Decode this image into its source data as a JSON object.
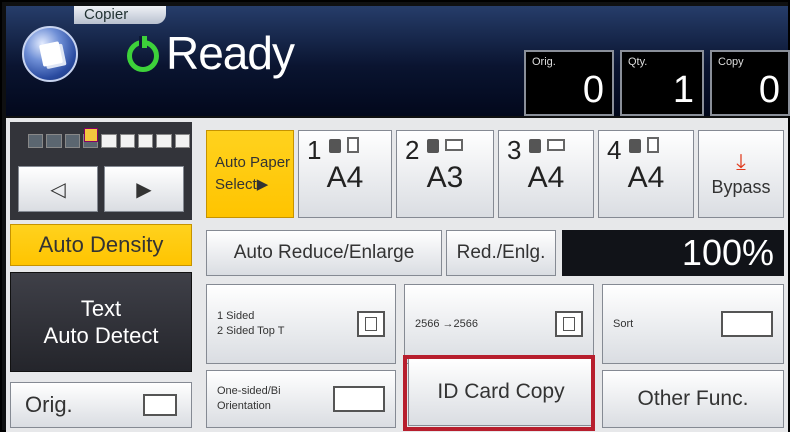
{
  "header": {
    "app_tab": "Copier",
    "status": "Ready",
    "counters": {
      "orig": {
        "label": "Orig.",
        "value": "0"
      },
      "qty": {
        "label": "Qty.",
        "value": "1"
      },
      "copy": {
        "label": "Copy",
        "value": "0"
      }
    }
  },
  "density": {
    "lighter_symbol": "◁",
    "darker_symbol": "▶",
    "auto_label": "Auto Density",
    "level_of_9": 4
  },
  "paper": {
    "auto_paper_line1": "Auto Paper",
    "auto_paper_line2": "Select▶",
    "trays": [
      {
        "num": "1",
        "size": "A4"
      },
      {
        "num": "2",
        "size": "A3"
      },
      {
        "num": "3",
        "size": "A4"
      },
      {
        "num": "4",
        "size": "A4"
      }
    ],
    "bypass": "Bypass"
  },
  "reduce": {
    "auto_reduce_enlarge": "Auto Reduce/Enlarge",
    "red_enlg": "Red./Enlg.",
    "ratio": "100%"
  },
  "original": {
    "text_mode_line1": "Text",
    "text_mode_line2": "Auto Detect",
    "orig_label": "Orig."
  },
  "functions": {
    "sided_line1": "1 Sided",
    "sided_line2": "2 Sided Top T",
    "page_layout": "2566 →2566",
    "sort": "Sort",
    "orientation_line1": "One-sided/Bi",
    "orientation_line2": "Orientation",
    "id_card_copy": "ID Card Copy",
    "other_func": "Other Func."
  },
  "colors": {
    "accent_yellow": "#ffc400",
    "ready_green": "#3dd23a",
    "highlight_red": "#b71e2d",
    "header_navy": "#0a1430"
  }
}
